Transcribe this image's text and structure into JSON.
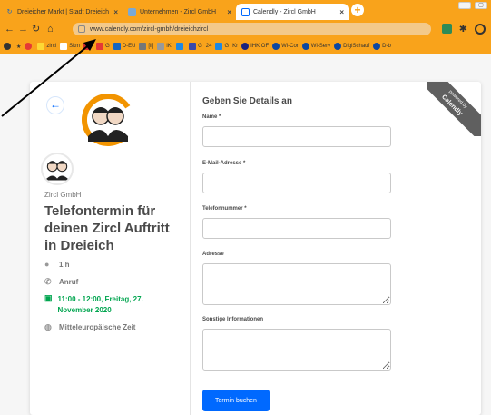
{
  "browser": {
    "tabs": [
      {
        "label": "Dreieicher Markt | Stadt Dreieich"
      },
      {
        "label": "Unternehmen - Zircl GmbH"
      },
      {
        "label": "Calendly - Zircl GmbH"
      }
    ],
    "address": "www.calendly.com/zircl-gmbh/dreieichzircl",
    "bookmarks": [
      "zircl",
      "Skm",
      "G",
      "D-EU",
      "[ii]",
      "iKi",
      "G",
      "24",
      "G",
      "Kr",
      "IHK OF",
      "Wi-Cor",
      "Wi-Serv",
      "DigiSchauf",
      "D-b"
    ]
  },
  "event": {
    "organizer": "Zircl GmbH",
    "title": "Telefontermin für deinen Zircl Auftritt in Dreieich",
    "duration": "1 h",
    "type": "Anruf",
    "datetime": "11:00 - 12:00, Freitag, 27. November 2020",
    "timezone": "Mitteleuropäische Zeit",
    "logo_text": "Zircl"
  },
  "form": {
    "title": "Geben Sie Details an",
    "name_label": "Name *",
    "email_label": "E-Mail-Adresse *",
    "phone_label": "Telefonnummer *",
    "address_label": "Adresse",
    "info_label": "Sonstige Informationen",
    "submit_label": "Termin buchen"
  },
  "ribbon": {
    "line1": "powered by",
    "line2": "Calendly"
  },
  "colors": {
    "browser_chrome": "#f9a31b",
    "accent": "#0069ff",
    "date_green": "#00a54f"
  }
}
